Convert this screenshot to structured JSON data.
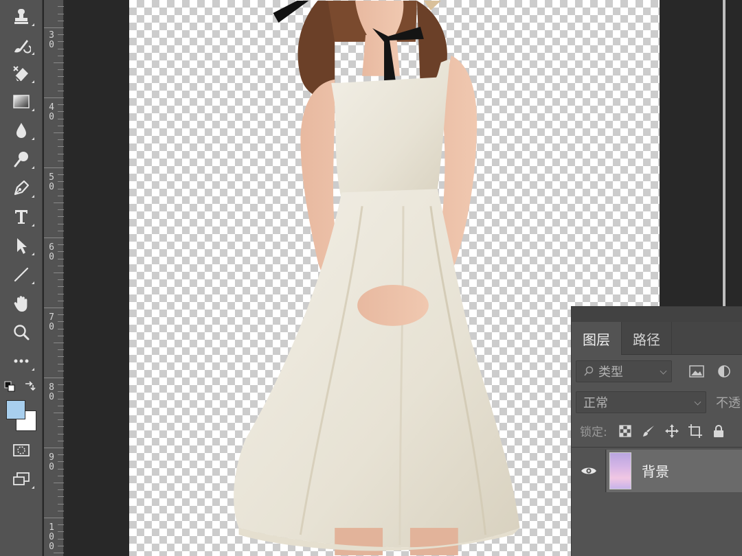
{
  "toolbar": {
    "tools": [
      {
        "name": "clone-stamp-tool",
        "icon": "stamp-icon"
      },
      {
        "name": "history-brush-tool",
        "icon": "history-brush-icon"
      },
      {
        "name": "eraser-tool",
        "icon": "eraser-icon"
      },
      {
        "name": "gradient-tool",
        "icon": "gradient-icon"
      },
      {
        "name": "blur-tool",
        "icon": "droplet-icon"
      },
      {
        "name": "dodge-tool",
        "icon": "dodge-icon"
      },
      {
        "name": "pen-tool",
        "icon": "pen-icon"
      },
      {
        "name": "type-tool",
        "icon": "type-icon",
        "label": "T"
      },
      {
        "name": "path-selection-tool",
        "icon": "arrow-icon"
      },
      {
        "name": "line-tool",
        "icon": "line-icon"
      },
      {
        "name": "hand-tool",
        "icon": "hand-icon"
      },
      {
        "name": "zoom-tool",
        "icon": "magnifier-icon"
      },
      {
        "name": "edit-toolbar",
        "icon": "more-icon",
        "label": "•••"
      }
    ],
    "foreground_color": "#a8cfee",
    "background_color": "#ffffff"
  },
  "ruler": {
    "labels": [
      {
        "top": "3",
        "bottom": "0"
      },
      {
        "top": "4",
        "bottom": "0"
      },
      {
        "top": "5",
        "bottom": "0"
      },
      {
        "top": "6",
        "bottom": "0"
      },
      {
        "top": "7",
        "bottom": "0"
      },
      {
        "top": "8",
        "bottom": "0"
      },
      {
        "top": "9",
        "bottom": "0"
      },
      {
        "top": "1",
        "middle": "0",
        "bottom": "0"
      }
    ]
  },
  "layers_panel": {
    "tabs": [
      "图层",
      "路径"
    ],
    "active_tab": "图层",
    "filter_placeholder": "类型",
    "blend_mode": "正常",
    "opacity_label": "不透",
    "lock_label": "锁定:",
    "layers": [
      {
        "name": "背景",
        "visible": true,
        "selected": true
      }
    ]
  }
}
